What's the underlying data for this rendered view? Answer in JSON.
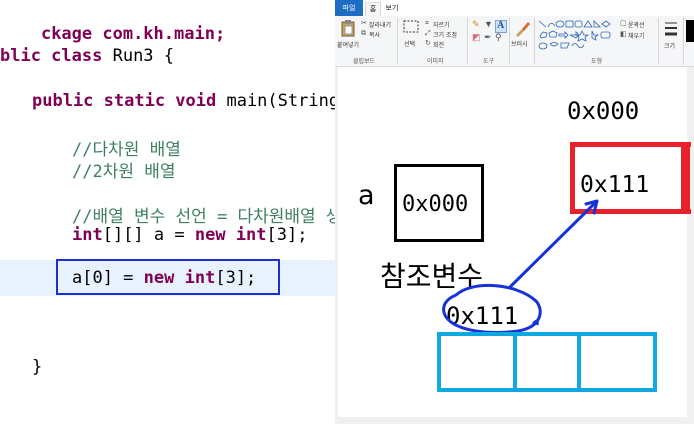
{
  "editor": {
    "lines": {
      "l1": "ckage com.kh.main;",
      "l2_kw": "blic class",
      "l2_rest": " Run3 {",
      "l3_kw1": "public static void",
      "l3_rest": " main(String",
      "c1": "//다차원 배열",
      "c2": "//2차원 배열",
      "c3": "//배열 변수 선언 = 다차원배열 생",
      "d1": "int",
      "d2": "[][] a = ",
      "d3": "new",
      "d4": " ",
      "d5": "int",
      "d6": "[3];",
      "h1": "a[0] = ",
      "h2": "new",
      "h3": " ",
      "h4": "int",
      "h5": "[3];",
      "brace": "}"
    }
  },
  "paint": {
    "tabs": {
      "file": "파일",
      "home": "홈",
      "view": "보기"
    },
    "ribbon": {
      "paste": "붙여넣기",
      "cut": "잘라내기",
      "copy": "복사",
      "clipboard": "클립보드",
      "select": "선택",
      "crop": "자르기",
      "resize": "크기 조정",
      "rotate": "회전",
      "image": "이미지",
      "tools": "도구",
      "brushes": "브러시",
      "outline": "윤곽선",
      "fill": "채우기",
      "shapes": "도형",
      "size": "크기"
    },
    "drawing": {
      "top_addr": "0x000",
      "var_name": "a",
      "var_value": "0x000",
      "ref_label": "참조변수",
      "red_value": "0x111",
      "circled_value": "0x111"
    },
    "colors": {
      "red": "#e8222a",
      "blue_ink": "#1733d6",
      "cyan": "#10a8e0",
      "highlight_box": "#1c2fd0"
    }
  }
}
